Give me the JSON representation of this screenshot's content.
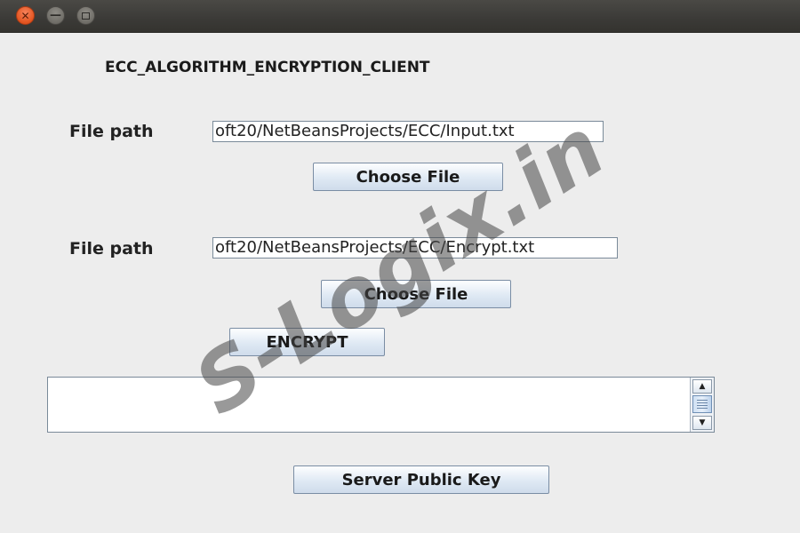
{
  "window": {
    "controls": {
      "close_glyph": "✕",
      "minimize_glyph": "—"
    }
  },
  "heading": "ECC_ALGORITHM_ENCRYPTION_CLIENT",
  "input_file": {
    "label": "File path",
    "value": "oft20/NetBeansProjects/ECC/Input.txt",
    "choose_button": "Choose File"
  },
  "encrypt_file": {
    "label": "File path",
    "value": "oft20/NetBeansProjects/ECC/Encrypt.txt",
    "choose_button": "Choose File"
  },
  "encrypt_button": "ENCRYPT",
  "output_area": {
    "value": "",
    "scroll_up_glyph": "▲",
    "scroll_down_glyph": "▼"
  },
  "server_public_key_button": "Server Public Key",
  "watermark": "S-Logix.in",
  "colors": {
    "close_button": "#e3541f",
    "button_gradient_top": "#fdfeff",
    "button_gradient_bottom": "#cfdceb",
    "window_background": "#ededed",
    "titlebar": "#3b3a37"
  }
}
